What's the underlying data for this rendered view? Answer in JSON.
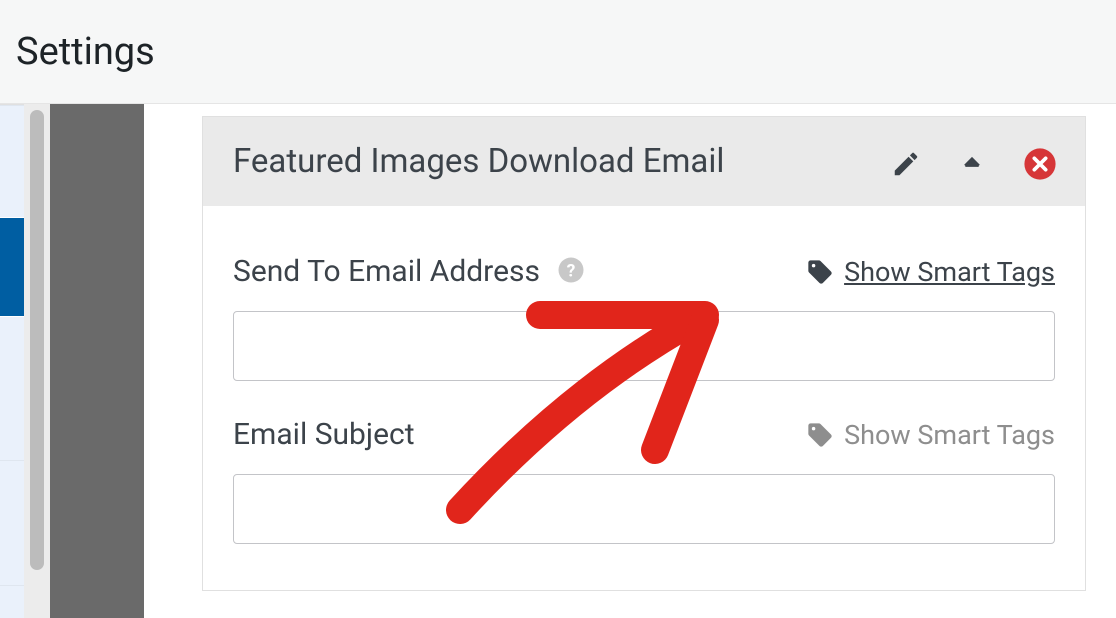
{
  "page": {
    "title": "Settings"
  },
  "panel": {
    "title": "Featured Images Download Email"
  },
  "fields": {
    "send_to": {
      "label": "Send To Email Address",
      "smart_tags_label": "Show Smart Tags",
      "value": ""
    },
    "subject": {
      "label": "Email Subject",
      "smart_tags_label": "Show Smart Tags",
      "value": ""
    }
  }
}
